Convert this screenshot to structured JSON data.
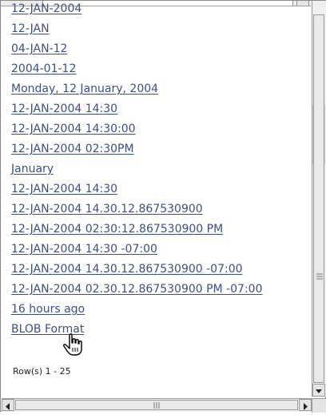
{
  "links": [
    "12-JAN-2004",
    "12-JAN",
    "04-JAN-12",
    "2004-01-12",
    "Monday, 12 January, 2004",
    "12-JAN-2004 14:30",
    "12-JAN-2004 14:30:00",
    "12-JAN-2004 02:30PM",
    "January",
    "12-JAN-2004 14:30",
    "12-JAN-2004 14.30.12.867530900",
    "12-JAN-2004 02:30:12.867530900 PM",
    "12-JAN-2004 14:30 -07:00",
    "12-JAN-2004 14.30.12.867530900 -07:00",
    "12-JAN-2004 02.30.12.867530900 PM -07:00",
    "16 hours ago",
    "BLOB Format"
  ],
  "pagination": {
    "rows_text": "Row(s) 1 - 25"
  },
  "colors": {
    "link": "#3b4f88",
    "scrollbar": "#f0f0f0"
  },
  "icons": {
    "cursor": "hand-pointer-icon",
    "scroll_up": "arrow-up-icon",
    "scroll_down": "arrow-down-icon",
    "scroll_left": "arrow-left-icon",
    "scroll_right": "arrow-right-icon"
  }
}
